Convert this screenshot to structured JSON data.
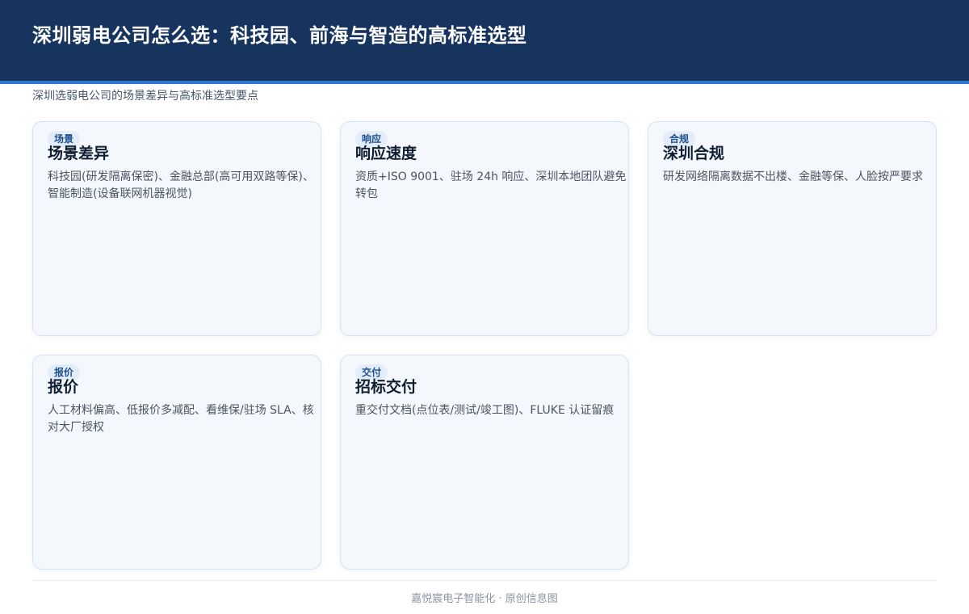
{
  "header": {
    "title": "深圳弱电公司怎么选：科技园、前海与智造的高标准选型"
  },
  "subtitle": "深圳选弱电公司的场景差异与高标准选型要点",
  "cards": [
    {
      "tag": "场景",
      "title": "场景差异",
      "desc": "科技园(研发隔离保密)、金融总部(高可用双路等保)、智能制造(设备联网机器视觉)"
    },
    {
      "tag": "响应",
      "title": "响应速度",
      "desc": "资质+ISO 9001、驻场 24h 响应、深圳本地团队避免转包"
    },
    {
      "tag": "合规",
      "title": "深圳合规",
      "desc": "研发网络隔离数据不出楼、金融等保、人脸按严要求"
    },
    {
      "tag": "报价",
      "title": "报价",
      "desc": "人工材料偏高、低报价多减配、看维保/驻场 SLA、核对大厂授权"
    },
    {
      "tag": "交付",
      "title": "招标交付",
      "desc": "重交付文档(点位表/测试/竣工图)、FLUKE 认证留痕"
    }
  ],
  "footer": "嘉悦宸电子智能化 · 原创信息图",
  "colors": {
    "header_bg": "#17345f",
    "header_accent": "#2f78d0",
    "card_bg": "#f4f7fb",
    "card_border": "#d7e3f1",
    "tag_bg": "#e3edf9",
    "tag_text": "#1e4f8f"
  }
}
